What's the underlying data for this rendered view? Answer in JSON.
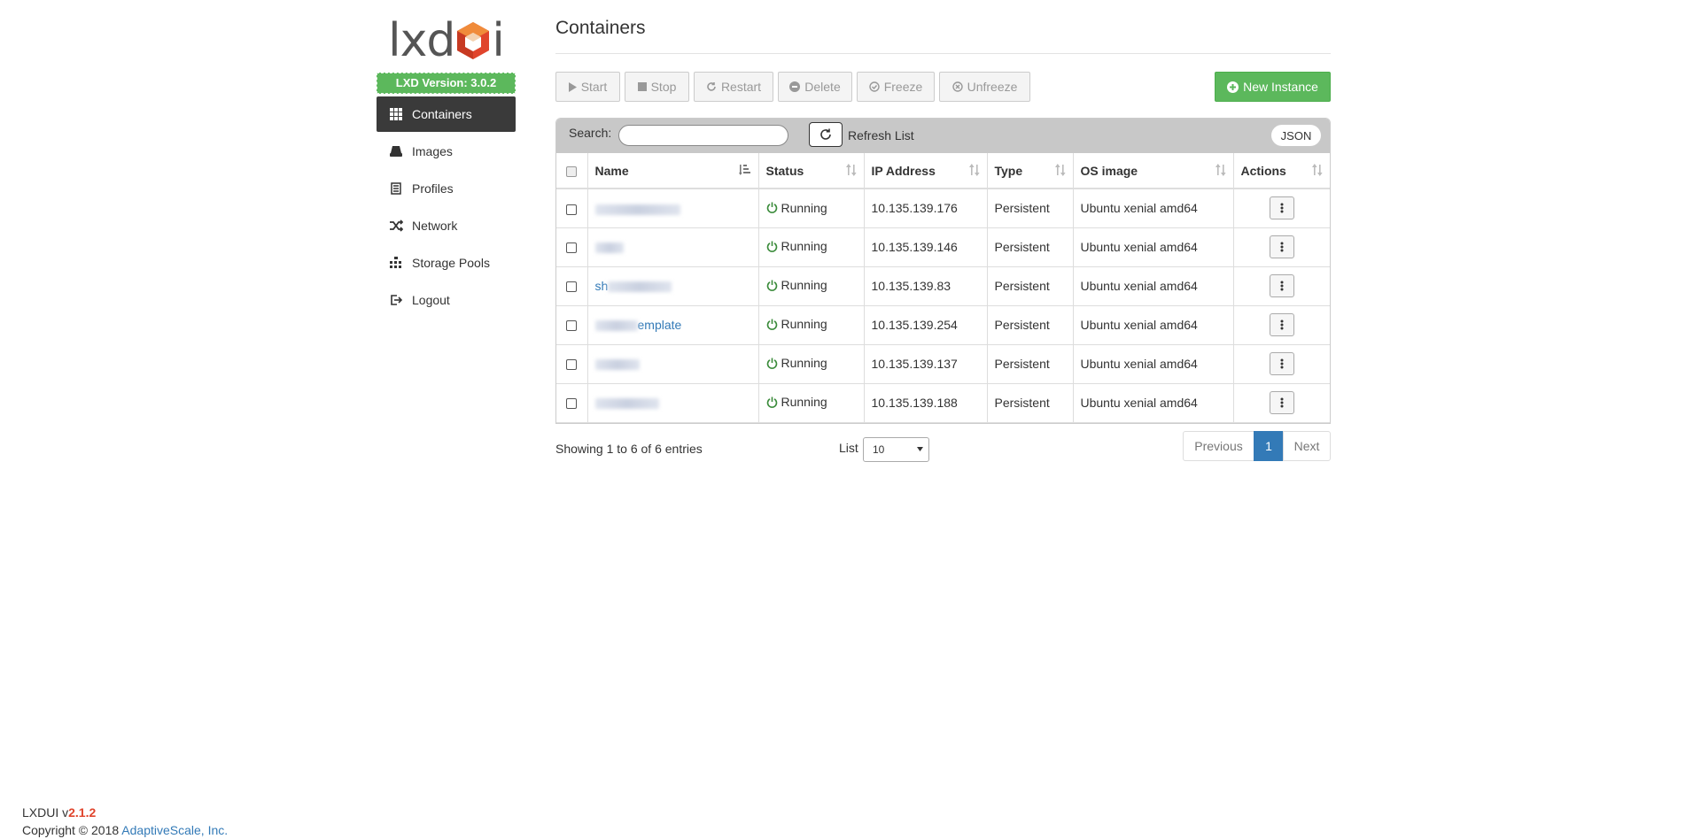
{
  "sidebar": {
    "logo_left": "lxd",
    "logo_right": "i",
    "lxd_version": "LXD Version: 3.0.2",
    "items": [
      {
        "label": "Containers",
        "icon": "grid-icon"
      },
      {
        "label": "Images",
        "icon": "drive-icon"
      },
      {
        "label": "Profiles",
        "icon": "profile-icon"
      },
      {
        "label": "Network",
        "icon": "shuffle-icon"
      },
      {
        "label": "Storage Pools",
        "icon": "sitemap-icon"
      },
      {
        "label": "Logout",
        "icon": "logout-icon"
      }
    ]
  },
  "main": {
    "title": "Containers",
    "toolbar": {
      "start": "Start",
      "stop": "Stop",
      "restart": "Restart",
      "delete": "Delete",
      "freeze": "Freeze",
      "unfreeze": "Unfreeze",
      "new_instance": "New Instance"
    },
    "search": {
      "label": "Search:",
      "value": "",
      "refresh_label": "Refresh List",
      "json_label": "JSON"
    },
    "table": {
      "headers": {
        "name": "Name",
        "status": "Status",
        "ip": "IP Address",
        "type": "Type",
        "os": "OS image",
        "actions": "Actions"
      },
      "rows": [
        {
          "name": "",
          "status": "Running",
          "ip": "10.135.139.176",
          "type": "Persistent",
          "os": "Ubuntu xenial amd64"
        },
        {
          "name": "",
          "status": "Running",
          "ip": "10.135.139.146",
          "type": "Persistent",
          "os": "Ubuntu xenial amd64"
        },
        {
          "name": "sh",
          "status": "Running",
          "ip": "10.135.139.83",
          "type": "Persistent",
          "os": "Ubuntu xenial amd64"
        },
        {
          "name": "emplate",
          "status": "Running",
          "ip": "10.135.139.254",
          "type": "Persistent",
          "os": "Ubuntu xenial amd64"
        },
        {
          "name": "",
          "status": "Running",
          "ip": "10.135.139.137",
          "type": "Persistent",
          "os": "Ubuntu xenial amd64"
        },
        {
          "name": "",
          "status": "Running",
          "ip": "10.135.139.188",
          "type": "Persistent",
          "os": "Ubuntu xenial amd64"
        }
      ]
    },
    "showing": "Showing 1 to 6 of 6 entries",
    "list_label": "List",
    "list_value": "10",
    "pagination": {
      "previous": "Previous",
      "current": "1",
      "next": "Next"
    }
  },
  "footer": {
    "app_name": "LXDUI v",
    "app_version": "2.1.2",
    "copyright": "Copyright © 2018 ",
    "company": "AdaptiveScale, Inc."
  },
  "colors": {
    "accent_green": "#5cb85c",
    "active_nav": "#3a3a3a",
    "link_blue": "#337ab7",
    "running_green": "#3c8c3c",
    "logo_orange": "#e0442c"
  }
}
